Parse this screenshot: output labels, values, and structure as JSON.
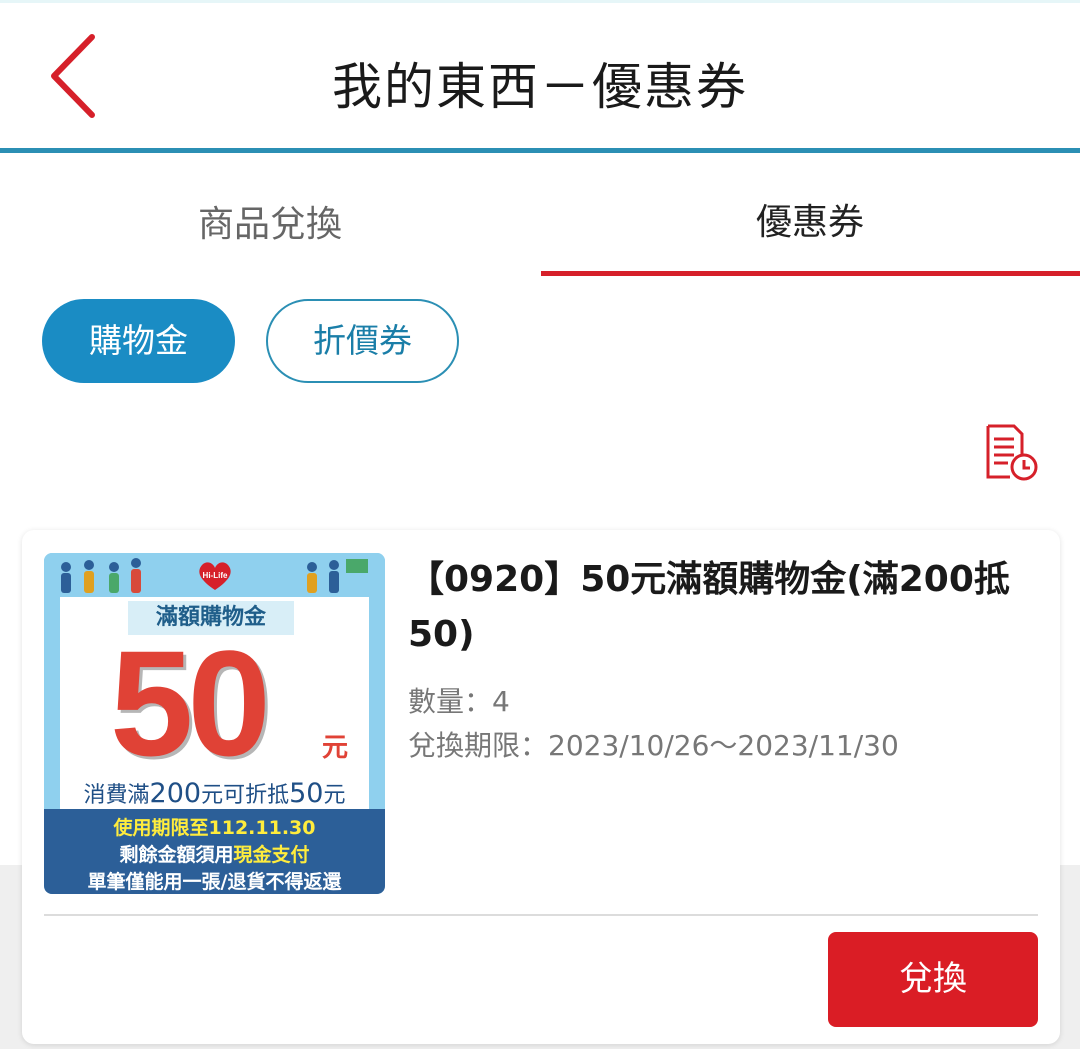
{
  "header": {
    "title": "我的東西－優惠券"
  },
  "tabs": [
    {
      "label": "商品兌換",
      "active": false
    },
    {
      "label": "優惠券",
      "active": true
    }
  ],
  "filters": [
    {
      "label": "購物金",
      "active": true
    },
    {
      "label": "折價券",
      "active": false
    }
  ],
  "colors": {
    "accent": "#1a8cc4",
    "brand_red": "#da1d25",
    "header_line": "#2b8fb4"
  },
  "coupon": {
    "title": "【0920】50元滿額購物金(滿200抵50)",
    "quantity": "數量：4",
    "period": "兌換期限：2023/10/26～2023/11/30",
    "redeem_label": "兌換",
    "image": {
      "logo_text": "Hi-Life",
      "label": "滿額購物金",
      "amount": "50",
      "unit": "元",
      "condition_prefix": "消費滿",
      "condition_min": "200",
      "condition_mid": "元可折抵",
      "condition_amount": "50",
      "condition_suffix": "元",
      "line1_a": "使用期限至",
      "line1_b": "112.11.30",
      "line2_a": "剩餘金額須用",
      "line2_b": "現金支付",
      "line3": "單筆僅能用一張/退貨不得返還"
    }
  }
}
